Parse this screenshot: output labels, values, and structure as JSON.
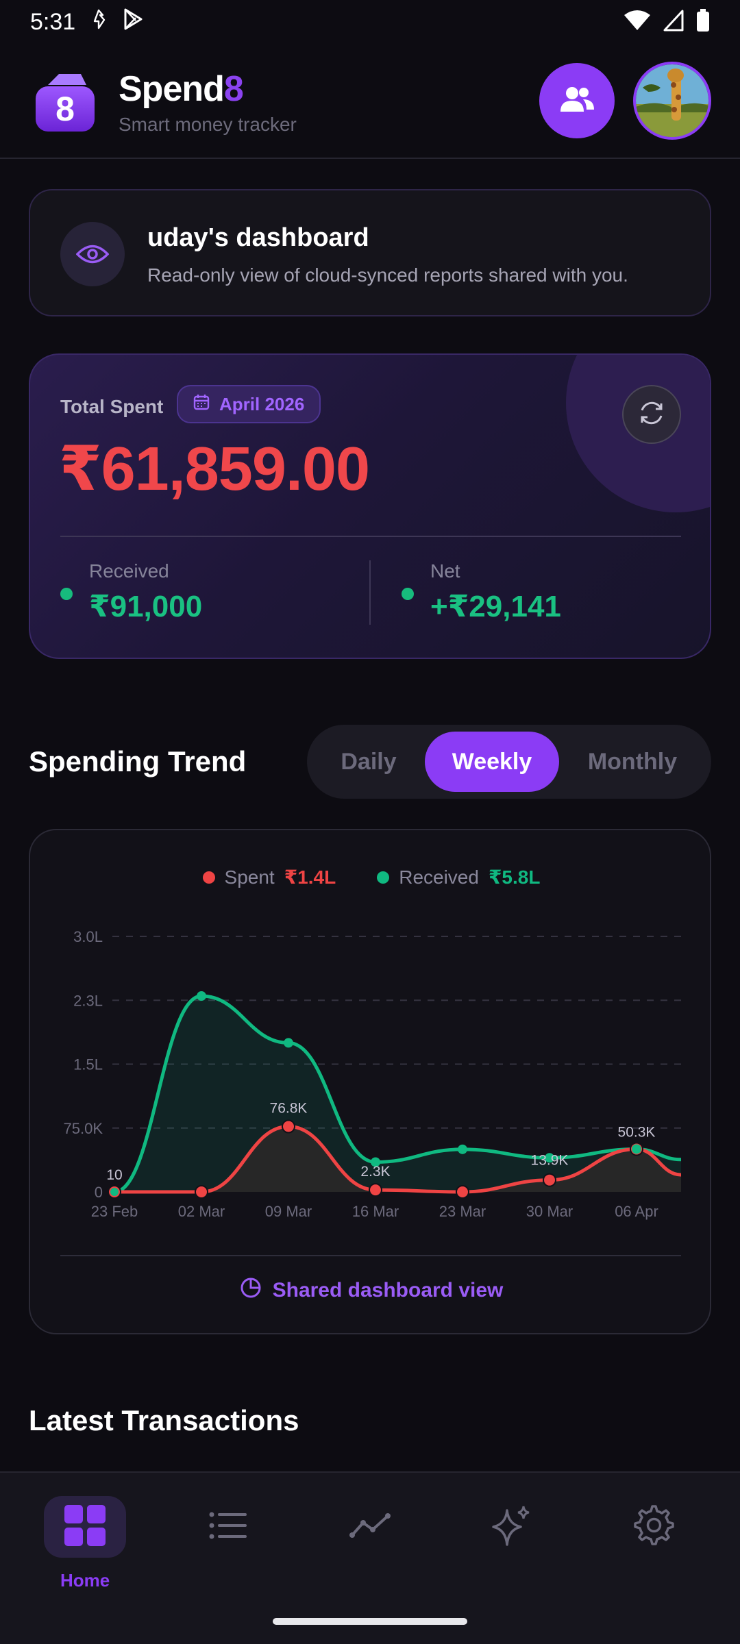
{
  "status_bar": {
    "time": "5:31"
  },
  "header": {
    "brand_main": "Spend",
    "brand_accent": "8",
    "logo_text": "8",
    "subtitle": "Smart money tracker"
  },
  "info_card": {
    "title": "uday's dashboard",
    "subtitle": "Read-only view of cloud-synced reports shared with you."
  },
  "summary": {
    "total_label": "Total Spent",
    "month": "April 2026",
    "total_amount": "₹61,859.00",
    "received_label": "Received",
    "received_value": "₹91,000",
    "net_label": "Net",
    "net_value": "+₹29,141"
  },
  "trend": {
    "title": "Spending Trend",
    "tabs": [
      "Daily",
      "Weekly",
      "Monthly"
    ],
    "active_tab": "Weekly",
    "legend": [
      {
        "name": "Spent",
        "value": "₹1.4L",
        "color": "#ef4444"
      },
      {
        "name": "Received",
        "value": "₹5.8L",
        "color": "#10b981"
      }
    ],
    "footer": "Shared dashboard view"
  },
  "chart_data": {
    "type": "line",
    "x": [
      "23 Feb",
      "02 Mar",
      "09 Mar",
      "16 Mar",
      "23 Mar",
      "30 Mar",
      "06 Apr"
    ],
    "y_ticks": [
      "3.0L",
      "2.3L",
      "1.5L",
      "75.0K",
      "0"
    ],
    "ylim": [
      0,
      300000
    ],
    "grid": true,
    "legend_position": "top-center",
    "series": [
      {
        "name": "Spent",
        "color": "#ef4444",
        "values": [
          10,
          0,
          76800,
          2300,
          0,
          13900,
          50300
        ],
        "labels": [
          "10",
          "",
          "76.8K",
          "2.3K",
          "",
          "13.9K",
          "50.3K"
        ]
      },
      {
        "name": "Received",
        "color": "#10b981",
        "values": [
          0,
          230000,
          175000,
          35000,
          50000,
          40000,
          50300
        ]
      }
    ]
  },
  "latest": {
    "title": "Latest Transactions"
  },
  "nav": {
    "items": [
      {
        "name": "Home",
        "icon": "grid-icon"
      },
      {
        "name": "Transactions",
        "icon": "list-icon"
      },
      {
        "name": "Analytics",
        "icon": "trend-icon"
      },
      {
        "name": "AI Insights",
        "icon": "sparkle-icon"
      },
      {
        "name": "Settings",
        "icon": "gear-icon"
      }
    ],
    "active_label": "Home"
  },
  "colors": {
    "accent": "#8b3cf5",
    "spent": "#ef4444",
    "received": "#10b981",
    "background": "#0d0c12"
  }
}
